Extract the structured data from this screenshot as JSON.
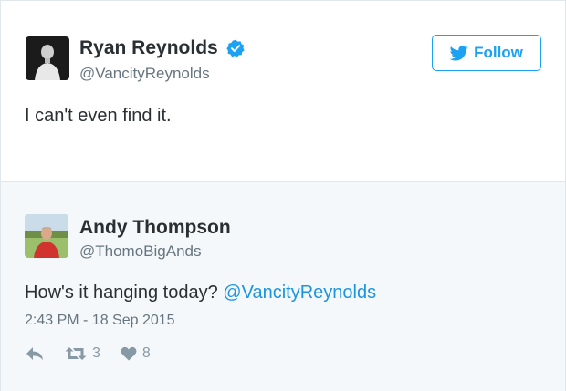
{
  "reply_tweet": {
    "display_name": "Ryan Reynolds",
    "handle": "@VancityReynolds",
    "text": "I can't even find it.",
    "follow_label": "Follow"
  },
  "main_tweet": {
    "display_name": "Andy Thompson",
    "handle": "@ThomoBigAnds",
    "text": "How's it hanging today? ",
    "mention": "@VancityReynolds",
    "timestamp": "2:43 PM - 18 Sep 2015",
    "retweet_count": "3",
    "like_count": "8"
  },
  "icons": {
    "verified": "verified-badge-icon",
    "twitter": "twitter-bird-icon",
    "reply": "reply-icon",
    "retweet": "retweet-icon",
    "like": "heart-icon"
  },
  "colors": {
    "accent": "#1da1f2",
    "mention": "#1b95e0",
    "muted": "#66757f",
    "main_background": "#f5f8fa"
  }
}
